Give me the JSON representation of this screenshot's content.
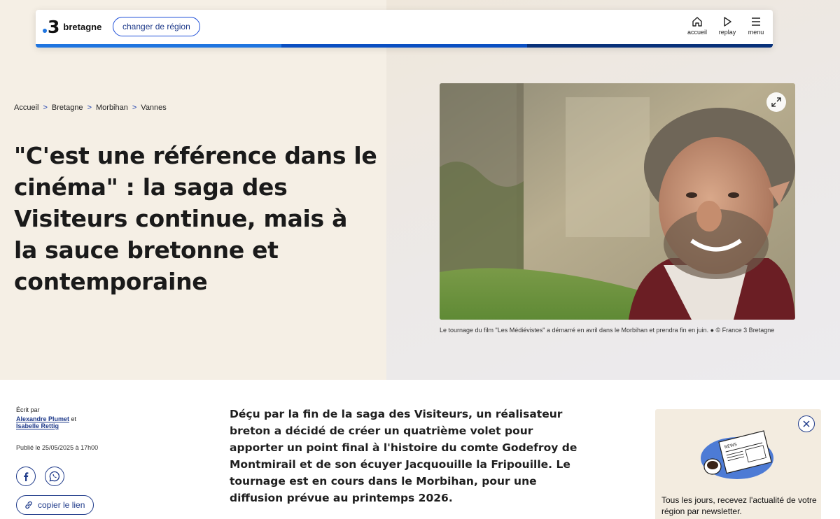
{
  "header": {
    "logo_number": "3",
    "logo_region": "bretagne",
    "change_region_label": "changer de région",
    "nav": {
      "home_label": "accueil",
      "replay_label": "replay",
      "menu_label": "menu"
    },
    "stripe_colors": [
      "#1f75e0",
      "#0a4fc2",
      "#08317a"
    ]
  },
  "breadcrumb": {
    "items": [
      "Accueil",
      "Bretagne",
      "Morbihan",
      "Vannes"
    ],
    "separator": ">"
  },
  "article": {
    "title": "\"C'est une référence dans le cinéma\" : la saga des Visiteurs continue, mais à la sauce bretonne et contemporaine",
    "image_caption": "Le tournage du film \"Les Médiévistes\" a démarré en avril dans le Morbihan et prendra fin en juin. ● © France 3 Bretagne",
    "byline_label": "Écrit par",
    "author_1": "Alexandre Plumet",
    "author_joiner": "et",
    "author_2": "Isabelle Rettig",
    "published": "Publié le 25/05/2025 à 17h00",
    "copy_link_label": "copier le lien",
    "lead": "Déçu par la fin de la saga des Visiteurs, un réalisateur breton a décidé de créer un quatrième volet pour apporter un point final à l'histoire du comte Godefroy de Montmirail et de son écuyer Jacquouille la Fripouille. Le tournage est en cours dans le Morbihan, pour une diffusion prévue au printemps 2026."
  },
  "share_icons": [
    "facebook-icon",
    "whatsapp-icon",
    "link-icon"
  ],
  "newsletter": {
    "text": "Tous les jours, recevez l'actualité de votre région par newsletter.",
    "art_label": "NEWS"
  },
  "colors": {
    "accent": "#1e3a8a",
    "hero_bg": "#f5efe5",
    "newsletter_bg": "#f3ece0"
  }
}
